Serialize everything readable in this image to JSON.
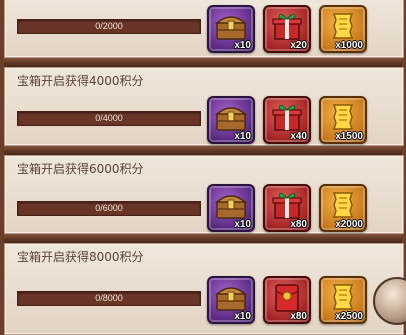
{
  "rewards": [
    {
      "title": "",
      "progress": "0/2000",
      "progress_fraction": 0,
      "items": [
        {
          "icon": "treasure-chest-icon",
          "qty": "x10",
          "rarity": "purple"
        },
        {
          "icon": "gift-box-icon",
          "qty": "x20",
          "rarity": "red"
        },
        {
          "icon": "gold-coupon-icon",
          "qty": "x1000",
          "rarity": "orange"
        }
      ]
    },
    {
      "title": "宝箱开启获得4000积分",
      "progress": "0/4000",
      "progress_fraction": 0,
      "items": [
        {
          "icon": "treasure-chest-icon",
          "qty": "x10",
          "rarity": "purple"
        },
        {
          "icon": "gift-box-icon",
          "qty": "x40",
          "rarity": "red"
        },
        {
          "icon": "gold-coupon-icon",
          "qty": "x1500",
          "rarity": "orange"
        }
      ]
    },
    {
      "title": "宝箱开启获得6000积分",
      "progress": "0/6000",
      "progress_fraction": 0,
      "items": [
        {
          "icon": "treasure-chest-icon",
          "qty": "x10",
          "rarity": "purple"
        },
        {
          "icon": "gift-box-icon",
          "qty": "x80",
          "rarity": "red"
        },
        {
          "icon": "gold-coupon-icon",
          "qty": "x2000",
          "rarity": "orange"
        }
      ]
    },
    {
      "title": "宝箱开启获得8000积分",
      "progress": "0/8000",
      "progress_fraction": 0,
      "items": [
        {
          "icon": "treasure-chest-icon",
          "qty": "x10",
          "rarity": "purple"
        },
        {
          "icon": "red-envelope-icon",
          "qty": "x80",
          "rarity": "red"
        },
        {
          "icon": "gold-coupon-icon",
          "qty": "x2500",
          "rarity": "orange"
        },
        {
          "icon": "pearl-orb-icon",
          "qty": "",
          "rarity": "silver"
        }
      ]
    }
  ],
  "colors": {
    "divider": "#5e3624",
    "panel": "#e9ddd0",
    "bar": "#6a3529",
    "purple_frame": "#5a2a82",
    "red_frame": "#a22424",
    "orange_frame": "#c87a1c"
  }
}
